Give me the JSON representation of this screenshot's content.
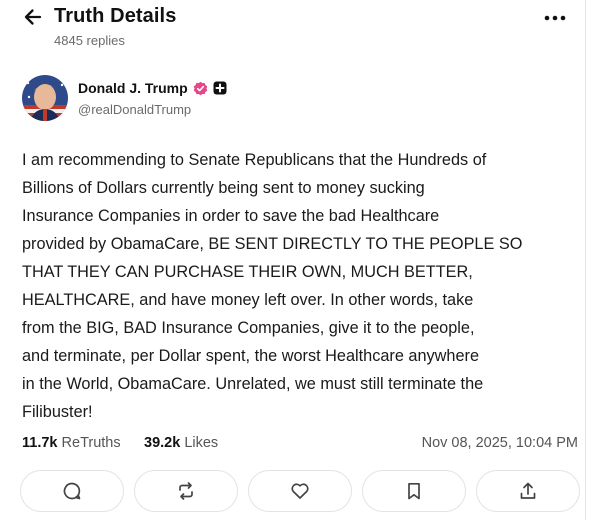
{
  "header": {
    "title": "Truth Details",
    "subtitle": "4845 replies",
    "back_icon": "arrow-left-icon",
    "more_icon": "more-horizontal-icon"
  },
  "author": {
    "name": "Donald J. Trump",
    "handle": "@realDonaldTrump",
    "verified_color": "#e5488a"
  },
  "post": {
    "text": "I am recommending to Senate Republicans that the Hundreds of\nBillions of Dollars currently being sent to money sucking\nInsurance Companies in order to save the bad Healthcare\nprovided by ObamaCare, BE SENT DIRECTLY TO THE PEOPLE SO\nTHAT THEY CAN PURCHASE THEIR OWN, MUCH BETTER,\nHEALTHCARE, and have money left over. In other words, take\nfrom the BIG, BAD Insurance Companies, give it to the people,\nand terminate, per Dollar spent, the worst Healthcare anywhere\nin the World, ObamaCare. Unrelated, we must still terminate the\nFilibuster!"
  },
  "stats": {
    "retruths_count": "11.7k",
    "retruths_label": "ReTruths",
    "likes_count": "39.2k",
    "likes_label": "Likes",
    "timestamp": "Nov 08, 2025, 10:04 PM"
  },
  "actions": [
    "reply-icon",
    "retruth-icon",
    "like-icon",
    "bookmark-icon",
    "share-icon"
  ]
}
